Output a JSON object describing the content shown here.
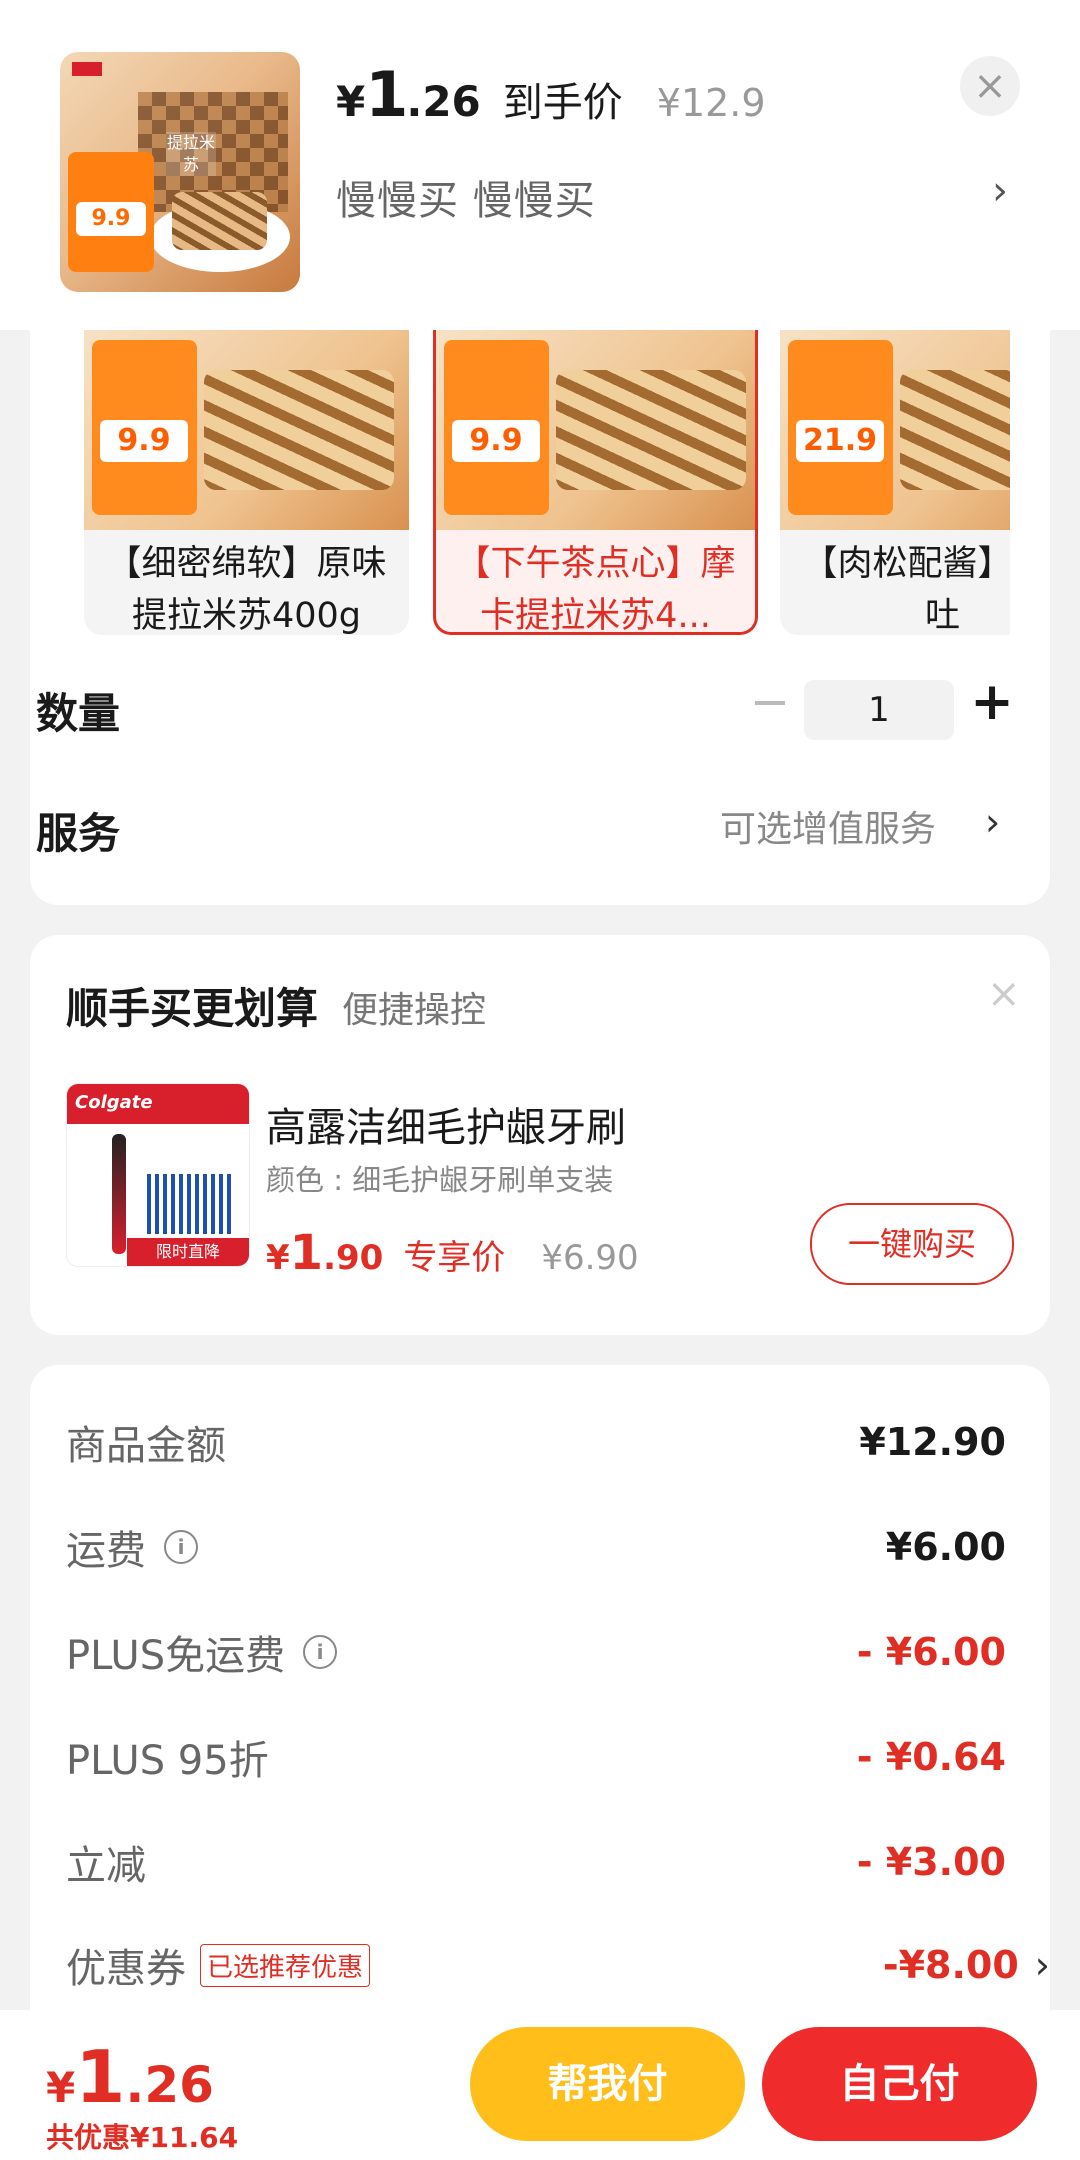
{
  "header": {
    "price_yen": "¥",
    "price_int": "1",
    "price_dec": ".26",
    "price_label": "到手价",
    "original_price": "¥12.9",
    "subtitle": "慢慢买  慢慢买",
    "close_icon": "×",
    "chevron": "›",
    "thumb_price": "9.9",
    "thumb_title": "提拉米苏"
  },
  "variants": [
    {
      "title": "【细密绵软】原味提拉米苏400g",
      "price": "9.9",
      "selected": false
    },
    {
      "title": "【下午茶点心】摩卡提拉米苏4...",
      "price": "9.9",
      "selected": true
    },
    {
      "title": "【肉松配酱】肉松吐",
      "price": "21.9",
      "selected": false
    }
  ],
  "quantity": {
    "label": "数量",
    "value": "1",
    "minus": "−",
    "plus": "+"
  },
  "service": {
    "label": "服务",
    "value": "可选增值服务",
    "chevron": "›"
  },
  "upsell": {
    "title": "顺手买更划算",
    "subtitle": "便捷操控",
    "close": "×",
    "brand": "Colgate",
    "img_badge": "限时直降",
    "name": "高露洁细毛护龈牙刷",
    "spec": "颜色 : 细毛护龈牙刷单支装",
    "price_yen": "¥",
    "price_int": "1",
    "price_dec": ".90",
    "price_label": "专享价",
    "original_price": "¥6.90",
    "buy_label": "一键购买"
  },
  "summary": [
    {
      "label": "商品金额",
      "value": "¥12.90",
      "red": false,
      "info": false
    },
    {
      "label": "运费",
      "value": "¥6.00",
      "red": false,
      "info": true
    },
    {
      "label": "PLUS免运费",
      "value": "- ¥6.00",
      "red": true,
      "info": true
    },
    {
      "label": "PLUS 95折",
      "value": "- ¥0.64",
      "red": true,
      "info": false
    },
    {
      "label": "立减",
      "value": "- ¥3.00",
      "red": true,
      "info": false
    },
    {
      "label": "优惠券",
      "value": "-¥8.00",
      "red": true,
      "info": false,
      "tag": "已选推荐优惠"
    }
  ],
  "bottom": {
    "total_yen": "¥",
    "total_int": "1",
    "total_dec": ".26",
    "saved": "共优惠¥11.64",
    "help_pay": "帮我付",
    "self_pay": "自己付"
  },
  "colors": {
    "accent_red": "#e02e24",
    "help_yellow": "#ffbe1a",
    "pay_red": "#ef2b2b"
  }
}
